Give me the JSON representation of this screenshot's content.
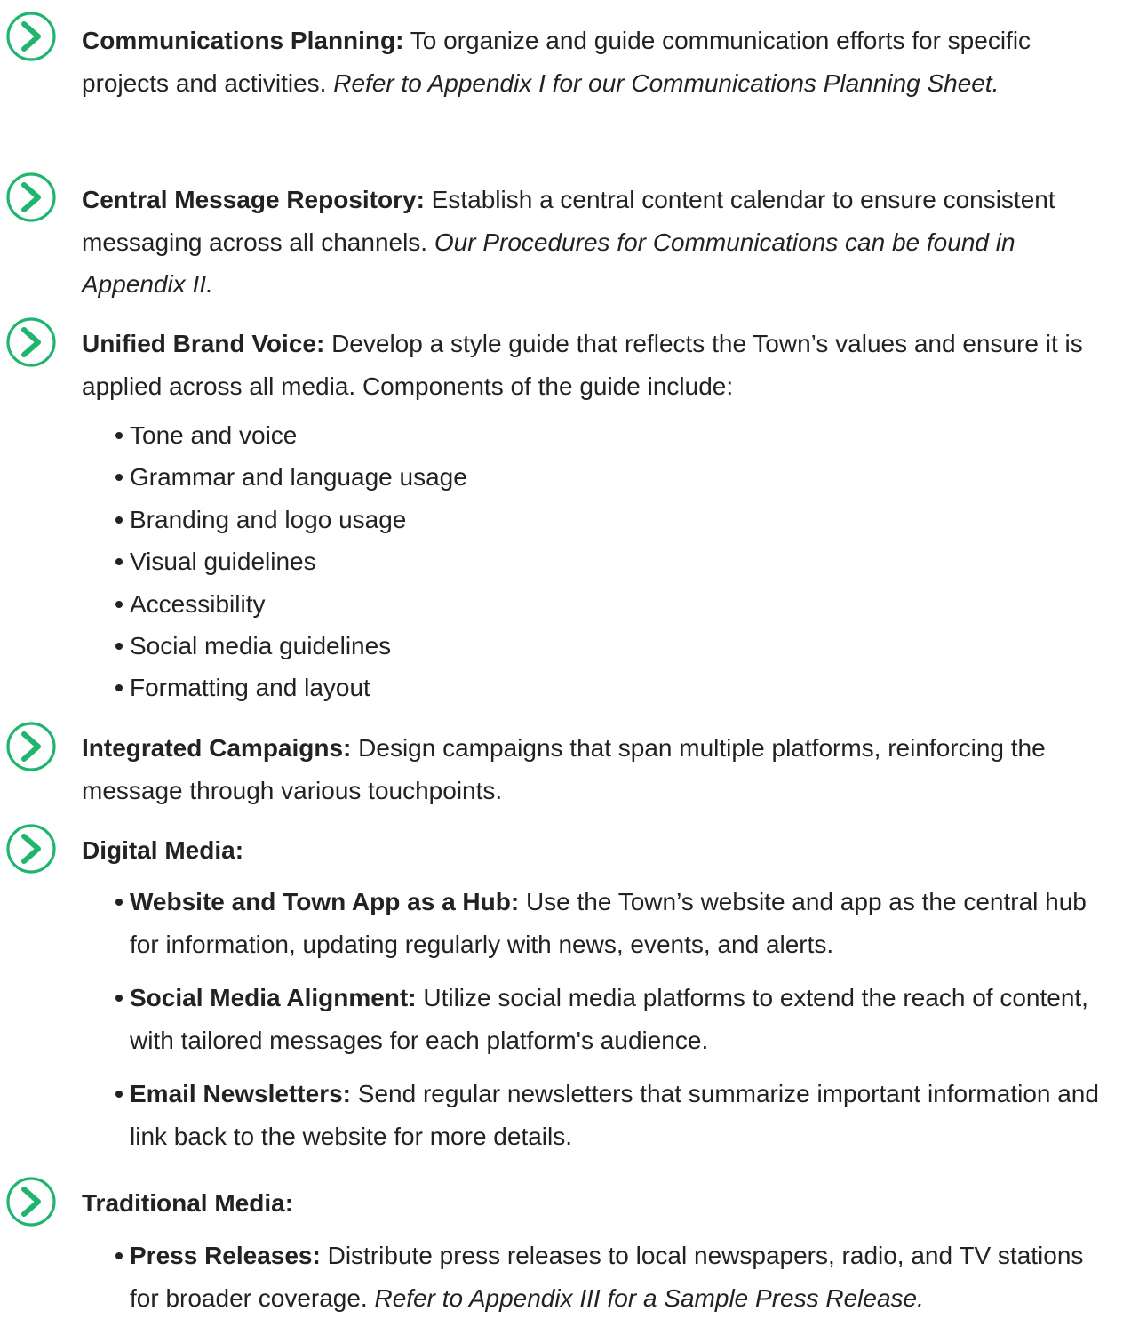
{
  "colors": {
    "accent": "#1fb56f",
    "text": "#222222"
  },
  "icon": "chevron-circle-right-icon",
  "items": [
    {
      "lead": "Communications Planning:",
      "text": " To organize and guide communication efforts for specific projects and activities. ",
      "italic": "Refer to Appendix I for our Communications Planning Sheet."
    },
    {
      "lead": "Central Message Repository:",
      "text": " Establish a central content calendar to ensure consistent messaging across all channels. ",
      "italic": "Our Procedures for Communications can be found in Appendix II."
    },
    {
      "lead": "Unified Brand Voice:",
      "text": " Develop a style guide that reflects the Town’s values and ensure it is applied across all media. Components of the guide include:",
      "bullets": [
        "Tone and voice",
        "Grammar and language usage",
        "Branding and logo usage",
        "Visual guidelines",
        "Accessibility",
        "Social media guidelines",
        "Formatting and layout"
      ]
    },
    {
      "lead": "Integrated Campaigns:",
      "text": " Design campaigns that span multiple platforms, reinforcing the message through various touchpoints."
    },
    {
      "lead": "Digital Media:",
      "subitems": [
        {
          "lead": "Website and Town App as a Hub:",
          "text": " Use the Town’s website and app as the central hub for information, updating regularly with news, events, and alerts."
        },
        {
          "lead": "Social Media Alignment:",
          "text": " Utilize social media platforms to extend the reach of content, with tailored messages for each platform's audience."
        },
        {
          "lead": "Email Newsletters:",
          "text": " Send regular newsletters that summarize important information and link back to the website for more details."
        }
      ]
    },
    {
      "lead": "Traditional Media:",
      "subitems": [
        {
          "lead": "Press Releases:",
          "text": " Distribute press releases to local newspapers, radio, and TV stations for broader coverage. ",
          "italic": "Refer to Appendix III for a Sample Press Release."
        }
      ]
    }
  ]
}
